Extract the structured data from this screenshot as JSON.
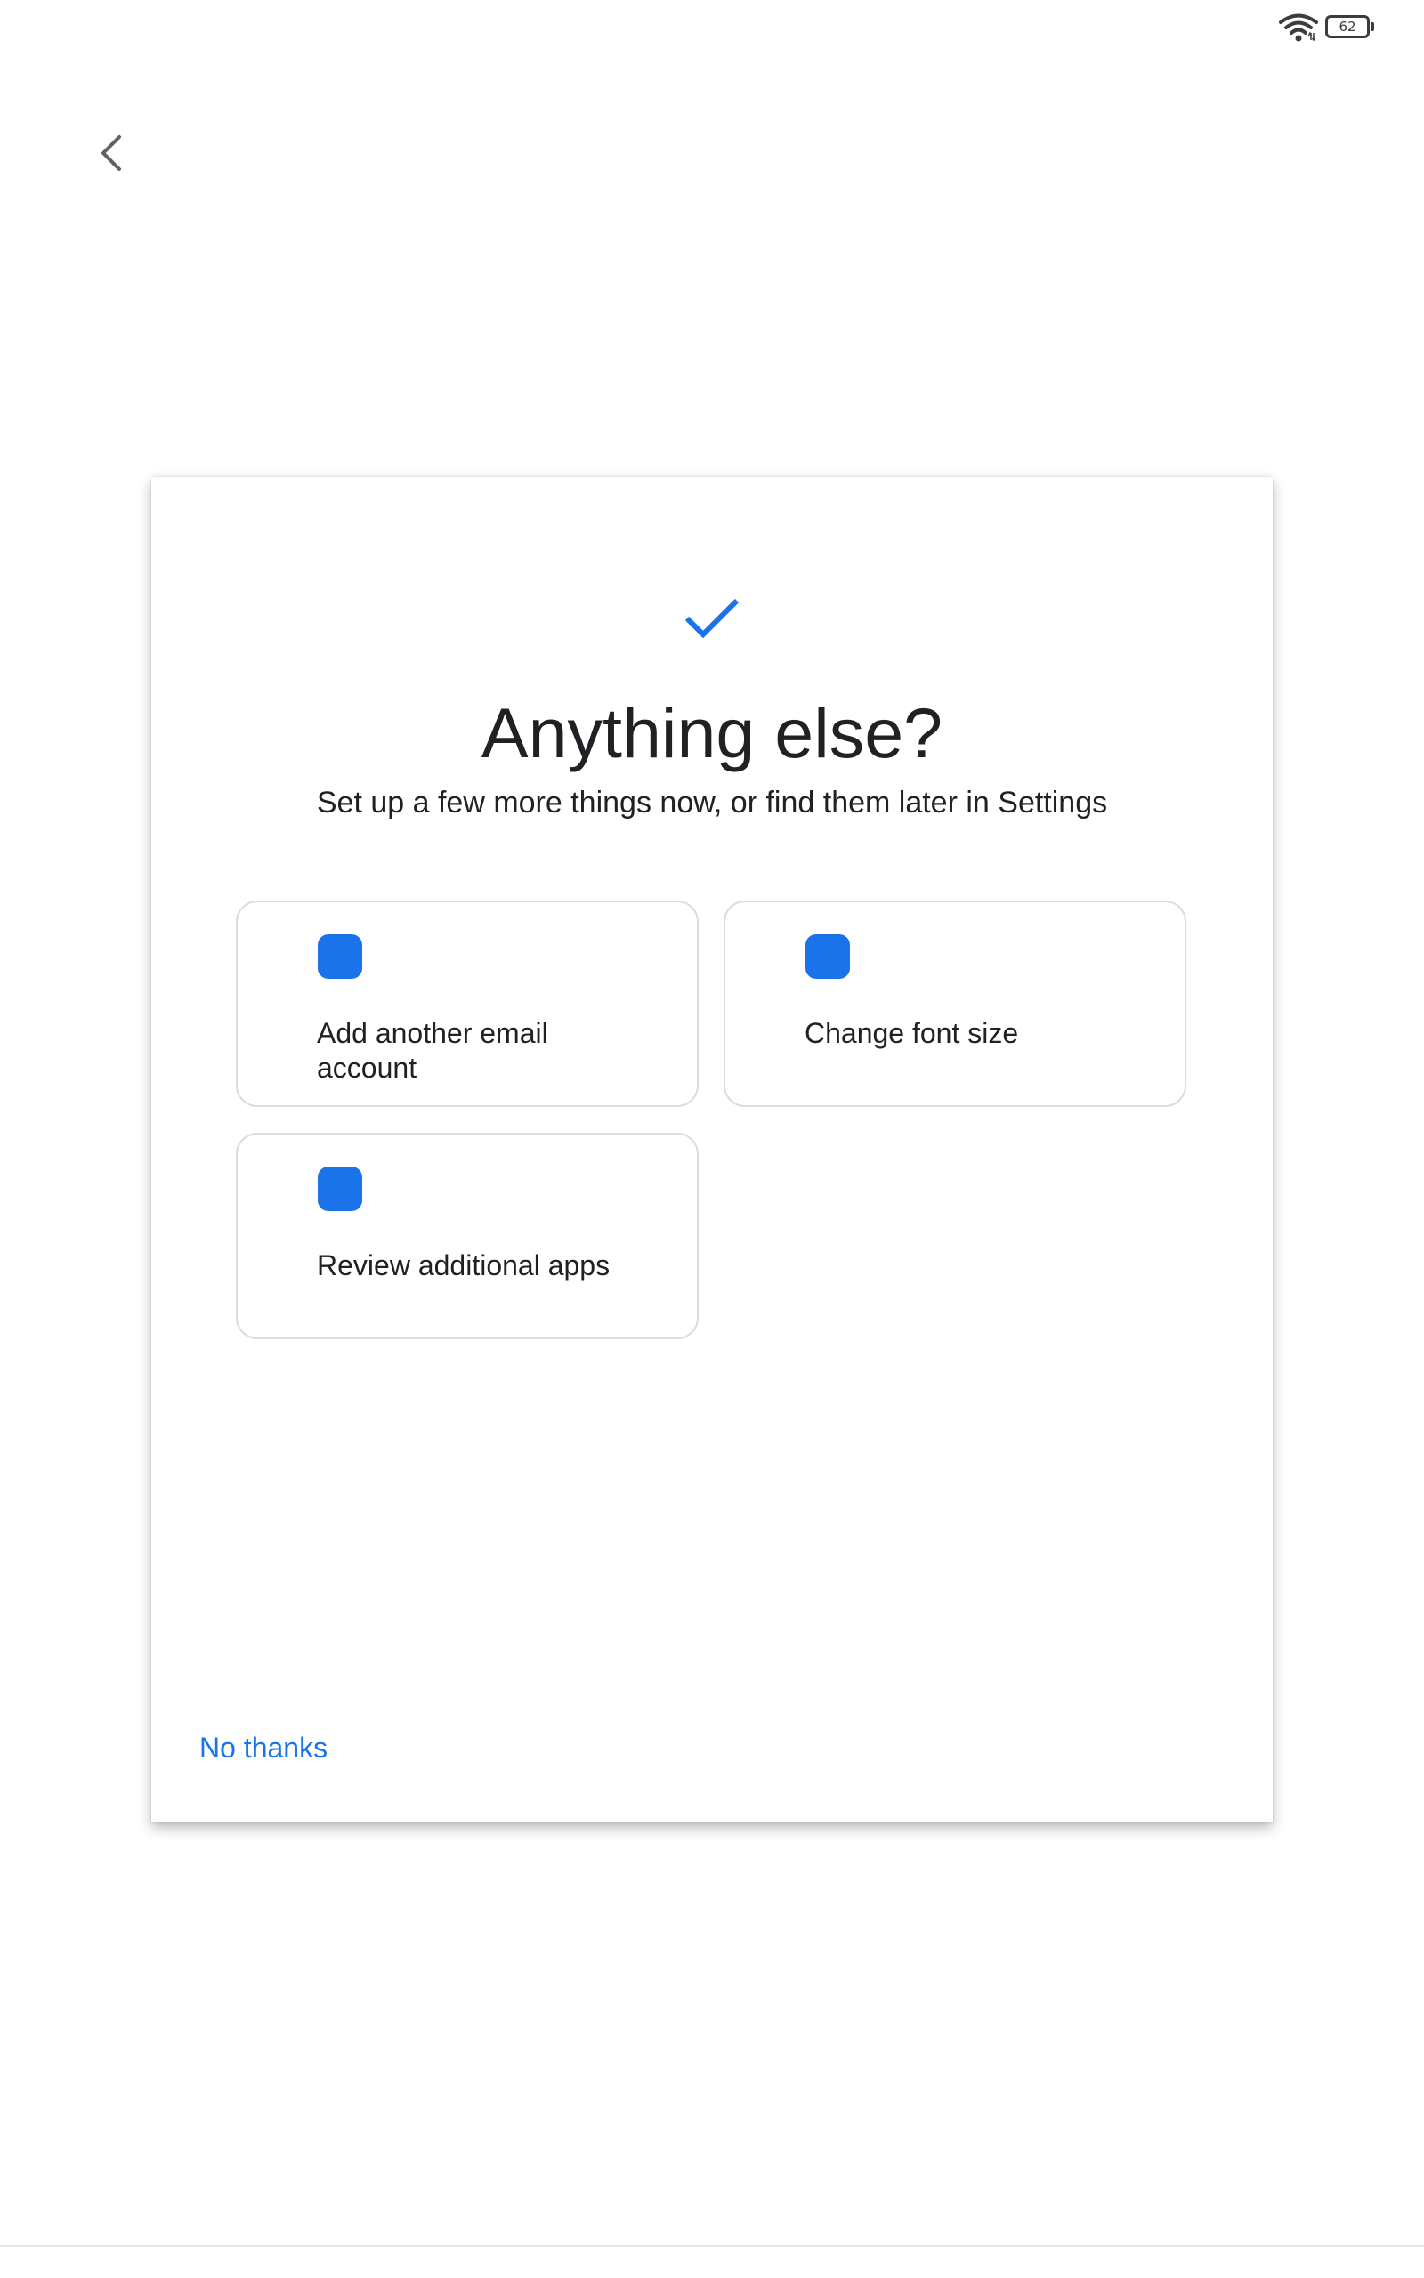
{
  "status_bar": {
    "battery_level": "62",
    "wifi_icon": "wifi-icon",
    "battery_icon": "battery-icon"
  },
  "navigation": {
    "back_icon": "chevron-left-icon"
  },
  "main": {
    "header_icon": "checkmark-icon",
    "title": "Anything else?",
    "subtitle": "Set up a few more things now, or find them later in Settings",
    "options": [
      {
        "label": "Add another email account",
        "icon_color": "#1a73e8"
      },
      {
        "label": "Change font size",
        "icon_color": "#1a73e8"
      },
      {
        "label": "Review additional apps",
        "icon_color": "#1a73e8"
      }
    ],
    "skip_label": "No thanks"
  },
  "colors": {
    "accent": "#1a73e8",
    "text": "#202124",
    "card_border": "#dadce0"
  }
}
